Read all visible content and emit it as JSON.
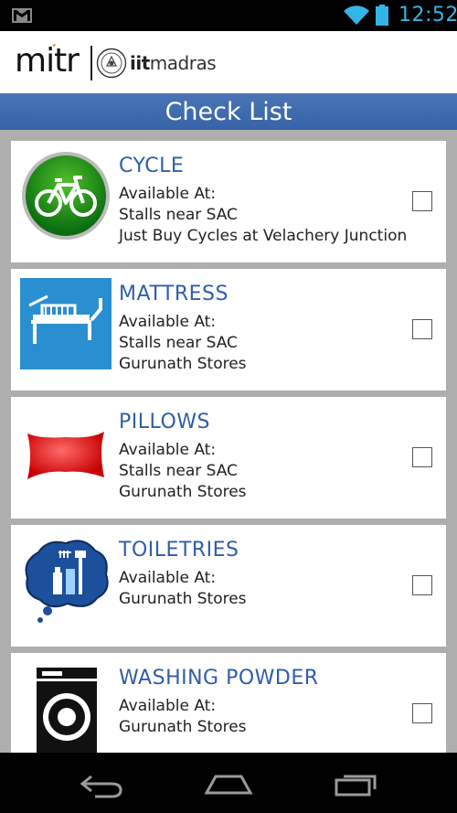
{
  "status_bar": {
    "time": "12:52"
  },
  "header": {
    "brand": "mitr",
    "partner_prefix": "iit",
    "partner_suffix": "madras"
  },
  "title": "Check List",
  "items": [
    {
      "title": "CYCLE",
      "available_label": "Available At:",
      "locations": [
        "Stalls near SAC",
        "Just Buy Cycles at Velachery Junction"
      ],
      "icon": "bicycle-icon",
      "checked": false
    },
    {
      "title": "MATTRESS",
      "available_label": "Available At:",
      "locations": [
        "Stalls near SAC",
        "Gurunath Stores"
      ],
      "icon": "bed-icon",
      "checked": false
    },
    {
      "title": "PILLOWS",
      "available_label": "Available At:",
      "locations": [
        "Stalls near SAC",
        "Gurunath Stores"
      ],
      "icon": "pillow-icon",
      "checked": false
    },
    {
      "title": "TOILETRIES",
      "available_label": "Available At:",
      "locations": [
        "Gurunath Stores"
      ],
      "icon": "toiletries-icon",
      "checked": false
    },
    {
      "title": "WASHING POWDER",
      "available_label": "Available At:",
      "locations": [
        "Gurunath Stores"
      ],
      "icon": "washing-machine-icon",
      "checked": false
    }
  ],
  "colors": {
    "accent": "#33b5e5",
    "title_bar": "#3d68ad",
    "item_title": "#2f5ea8",
    "list_bg": "#aeaeae"
  }
}
